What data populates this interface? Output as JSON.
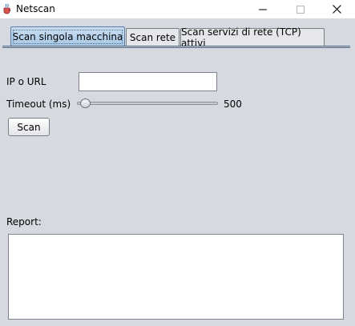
{
  "window": {
    "title": "Netscan",
    "icon": "java-cup-icon",
    "controls": {
      "minimize": "minimize-icon",
      "maximize": "maximize-icon",
      "close": "close-icon"
    }
  },
  "tabs": [
    {
      "label": "Scan singola macchina",
      "active": true
    },
    {
      "label": "Scan rete",
      "active": false
    },
    {
      "label": "Scan servizi di rete (TCP) attivi",
      "active": false
    }
  ],
  "form": {
    "ip_label": "IP o URL",
    "ip_value": "",
    "timeout_label": "Timeout (ms)",
    "timeout_value": "500",
    "timeout_slider_fraction": 0.05,
    "scan_label": "Scan"
  },
  "report": {
    "label": "Report:",
    "content": ""
  },
  "colors": {
    "background": "#d6d9df",
    "active_tab": "#b9d3ec"
  }
}
